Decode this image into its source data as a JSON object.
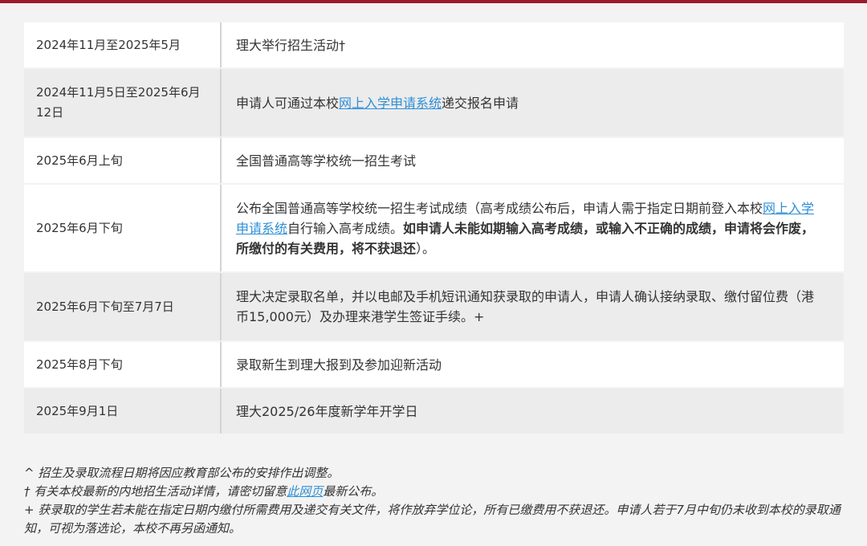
{
  "rows": [
    {
      "date": "2024年11月至2025年5月",
      "text": "理大举行招生活动†"
    },
    {
      "date": "2024年11月5日至2025年6月12日",
      "pre": "申请人可通过本校",
      "link": "网上入学申请系统",
      "post": "递交报名申请"
    },
    {
      "date": "2025年6月上旬",
      "text": "全国普通高等学校统一招生考试"
    },
    {
      "date": "2025年6月下旬",
      "pre": "公布全国普通高等学校统一招生考试成绩（高考成绩公布后，申请人需于指定日期前登入本校",
      "link": "网上入学申请系统",
      "post": "自行输入高考成绩。",
      "bold": "如申请人未能如期输入高考成绩，或输入不正确的成绩，申请将会作废，所缴付的有关费用，将不获退还",
      "end": "）。"
    },
    {
      "date": "2025年6月下旬至7月7日",
      "text": "理大决定录取名单，并以电邮及手机短讯通知获录取的申请人，申请人确认接纳录取、缴付留位费（港币15,000元）及办理来港学生签证手续。+"
    },
    {
      "date": "2025年8月下旬",
      "text": "录取新生到理大报到及参加迎新活动"
    },
    {
      "date": "2025年9月1日",
      "text": "理大2025/26年度新学年开学日"
    }
  ],
  "notes": {
    "n1": "^ 招生及录取流程日期将因应教育部公布的安排作出调整。",
    "n2_pre": "† 有关本校最新的内地招生活动详情，请密切留意",
    "n2_link": "此网页",
    "n2_post": "最新公布。",
    "n3": "+ 获录取的学生若未能在指定日期内缴付所需费用及递交有关文件，将作放弃学位论，所有已缴费用不获退还。申请人若于7月中旬仍未收到本校的录取通知，可视为落选论，本校不再另函通知。"
  },
  "colors": {
    "accent": "#9b1c2c",
    "link": "#2e8fd6"
  }
}
